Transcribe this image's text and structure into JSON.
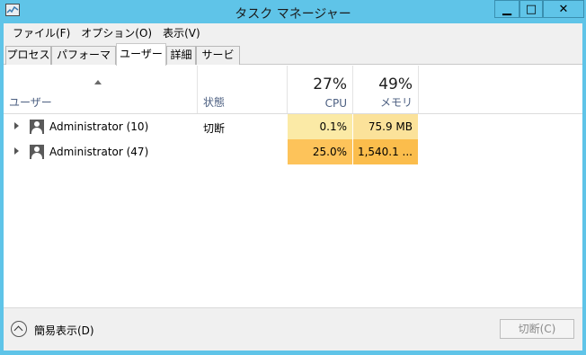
{
  "window": {
    "title": "タスク マネージャー",
    "controls": {
      "minimize": "▁",
      "maximize": "□",
      "close": "✕"
    }
  },
  "menu": [
    "ファイル(F)",
    "オプション(O)",
    "表示(V)"
  ],
  "tabs": [
    {
      "label": "プロセス",
      "active": false
    },
    {
      "label": "パフォーマンス",
      "active": false
    },
    {
      "label": "ユーザー",
      "active": true
    },
    {
      "label": "詳細",
      "active": false
    },
    {
      "label": "サービス",
      "active": false
    }
  ],
  "columns": {
    "user": {
      "label": "ユーザー",
      "sorted": "ascending"
    },
    "status": {
      "label": "状態"
    },
    "cpu": {
      "label": "CPU",
      "total": "27%"
    },
    "memory": {
      "label": "メモリ",
      "total": "49%"
    }
  },
  "rows": [
    {
      "name": "Administrator (10)",
      "status": "切断",
      "cpu": "0.1%",
      "memory": "75.9 MB",
      "cpu_color": "#fbeaa6",
      "mem_color": "#fbe29a"
    },
    {
      "name": "Administrator (47)",
      "status": "",
      "cpu": "25.0%",
      "memory": "1,540.1 ...",
      "cpu_color": "#fdc35a",
      "mem_color": "#fbbd4c"
    }
  ],
  "footer": {
    "collapse_label": "簡易表示(D)",
    "disconnect_button": "切断(C)"
  },
  "colors": {
    "frame": "#5fc4e8",
    "header_text": "#4d6082"
  }
}
